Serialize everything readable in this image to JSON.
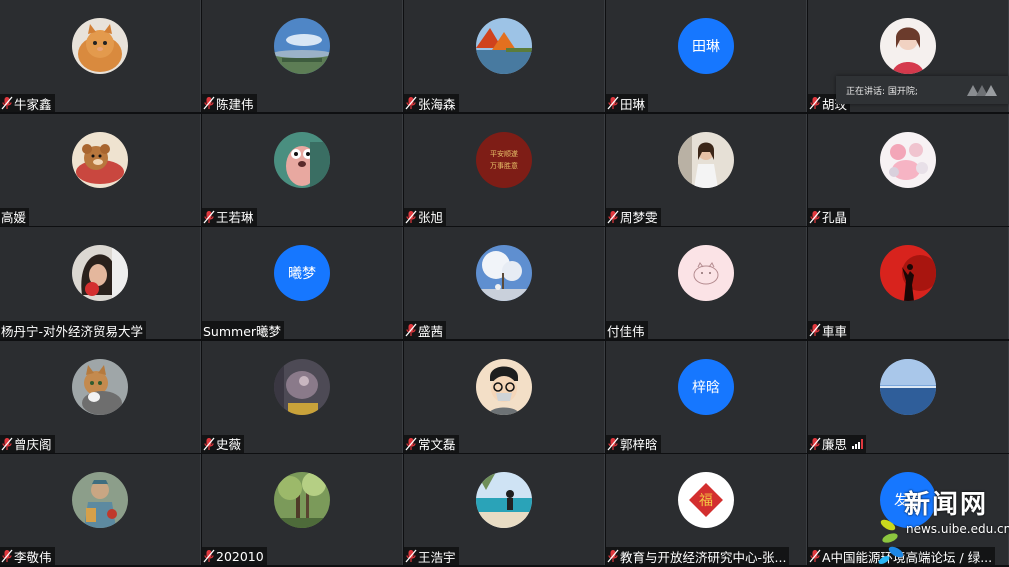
{
  "participants": [
    {
      "name": "牛家鑫",
      "muted": true,
      "avatar": "photo-cat-orange"
    },
    {
      "name": "陈建伟",
      "muted": true,
      "avatar": "photo-landscape-sky"
    },
    {
      "name": "张海森",
      "muted": true,
      "avatar": "photo-autumn-lake"
    },
    {
      "name": "田琳",
      "muted": true,
      "avatar_text": "田琳"
    },
    {
      "name": "胡玫",
      "muted": true,
      "avatar": "photo-girl-portrait"
    },
    {
      "name": "高媛",
      "muted": false,
      "avatar": "photo-cartoon-bear"
    },
    {
      "name": "王若琳",
      "muted": true,
      "avatar": "photo-cartoon-creature"
    },
    {
      "name": "张旭",
      "muted": true,
      "avatar": "photo-red-calligraphy",
      "avatar_caption": [
        "平安顺遂",
        "万事胜意"
      ]
    },
    {
      "name": "周梦雯",
      "muted": true,
      "avatar": "photo-child"
    },
    {
      "name": "孔晶",
      "muted": true,
      "avatar": "photo-cartoon-pink"
    },
    {
      "name": "杨丹宁-对外经济贸易大学",
      "muted": false,
      "avatar": "photo-woman-portrait"
    },
    {
      "name": "Summer曦梦",
      "muted": false,
      "avatar_text": "曦梦"
    },
    {
      "name": "盛茜",
      "muted": true,
      "avatar": "photo-cherry-tree"
    },
    {
      "name": "付佳伟",
      "muted": false,
      "avatar": "photo-pink-sketch"
    },
    {
      "name": "車車",
      "muted": true,
      "avatar": "photo-red-silhouette"
    },
    {
      "name": "曾庆阁",
      "muted": true,
      "avatar": "photo-cat-tabby"
    },
    {
      "name": "史薇",
      "muted": true,
      "avatar": "photo-dim-room"
    },
    {
      "name": "常文磊",
      "muted": true,
      "avatar": "photo-cartoon-glasses"
    },
    {
      "name": "郭梓晗",
      "muted": true,
      "avatar_text": "梓晗"
    },
    {
      "name": "廉思",
      "muted": true,
      "avatar": "photo-sea-horizon",
      "signal": true
    },
    {
      "name": "李敬伟",
      "muted": true,
      "avatar": "photo-statue"
    },
    {
      "name": "202010",
      "muted": true,
      "avatar": "photo-forest"
    },
    {
      "name": "王浩宇",
      "muted": true,
      "avatar": "photo-beach"
    },
    {
      "name": "教育与开放经济研究中心-张...",
      "muted": true,
      "avatar": "photo-fu-character"
    },
    {
      "name": "A中国能源环境高端论坛 / 绿...",
      "muted": true,
      "avatar_text": "发言"
    }
  ],
  "speaking": {
    "label": "正在讲话: 国开院;"
  },
  "watermark": {
    "title": "新闻网",
    "url": "news.uibe.edu.cn"
  },
  "colors": {
    "avatar_blue": "#1677ff",
    "tile_bg": "#2b2d30",
    "mic_muted": "#e0383e"
  }
}
